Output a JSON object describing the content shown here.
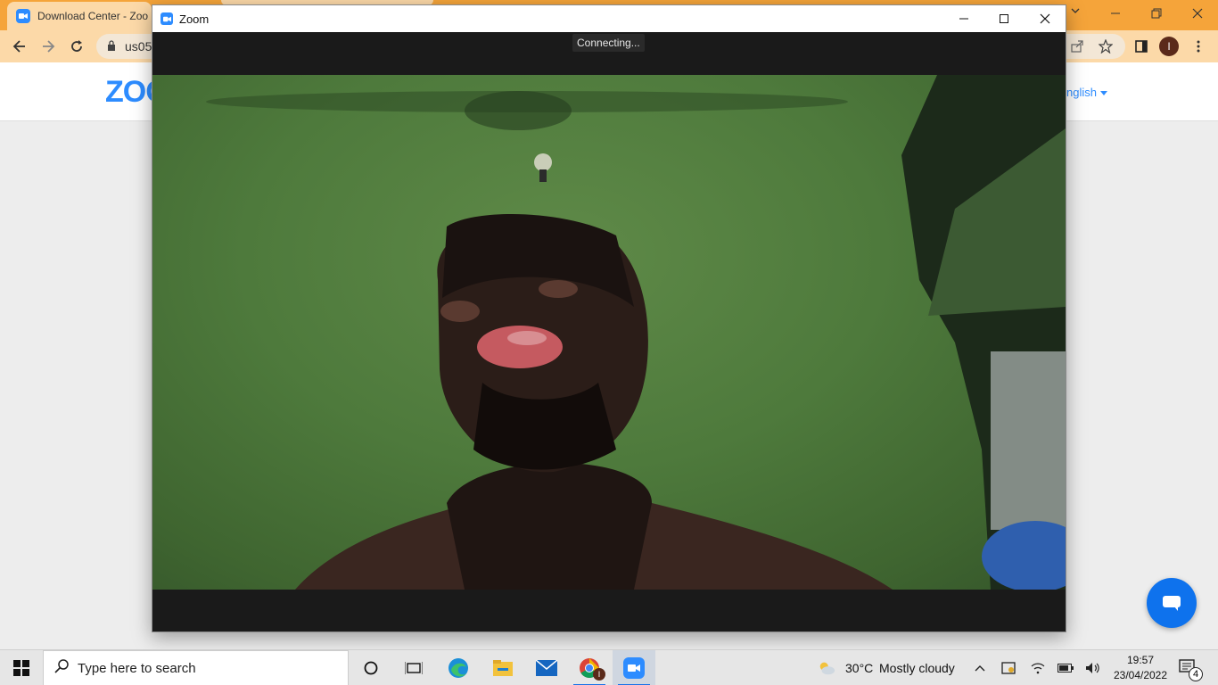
{
  "browser": {
    "tab_title": "Download Center - Zoo",
    "url_fragment": "us05",
    "avatar_initial": "I"
  },
  "page": {
    "logo_text": "ZOO",
    "language_link": "nglish"
  },
  "zoom_window": {
    "title": "Zoom",
    "status": "Connecting..."
  },
  "taskbar": {
    "search_placeholder": "Type here to search",
    "weather_temp": "30°C",
    "weather_desc": "Mostly cloudy",
    "time": "19:57",
    "date": "23/04/2022",
    "notification_count": "4",
    "chrome_badge": "I"
  },
  "colors": {
    "chrome_accent": "#f5a43a",
    "zoom_blue": "#2d8cff",
    "chat_blue": "#0e72ed"
  }
}
